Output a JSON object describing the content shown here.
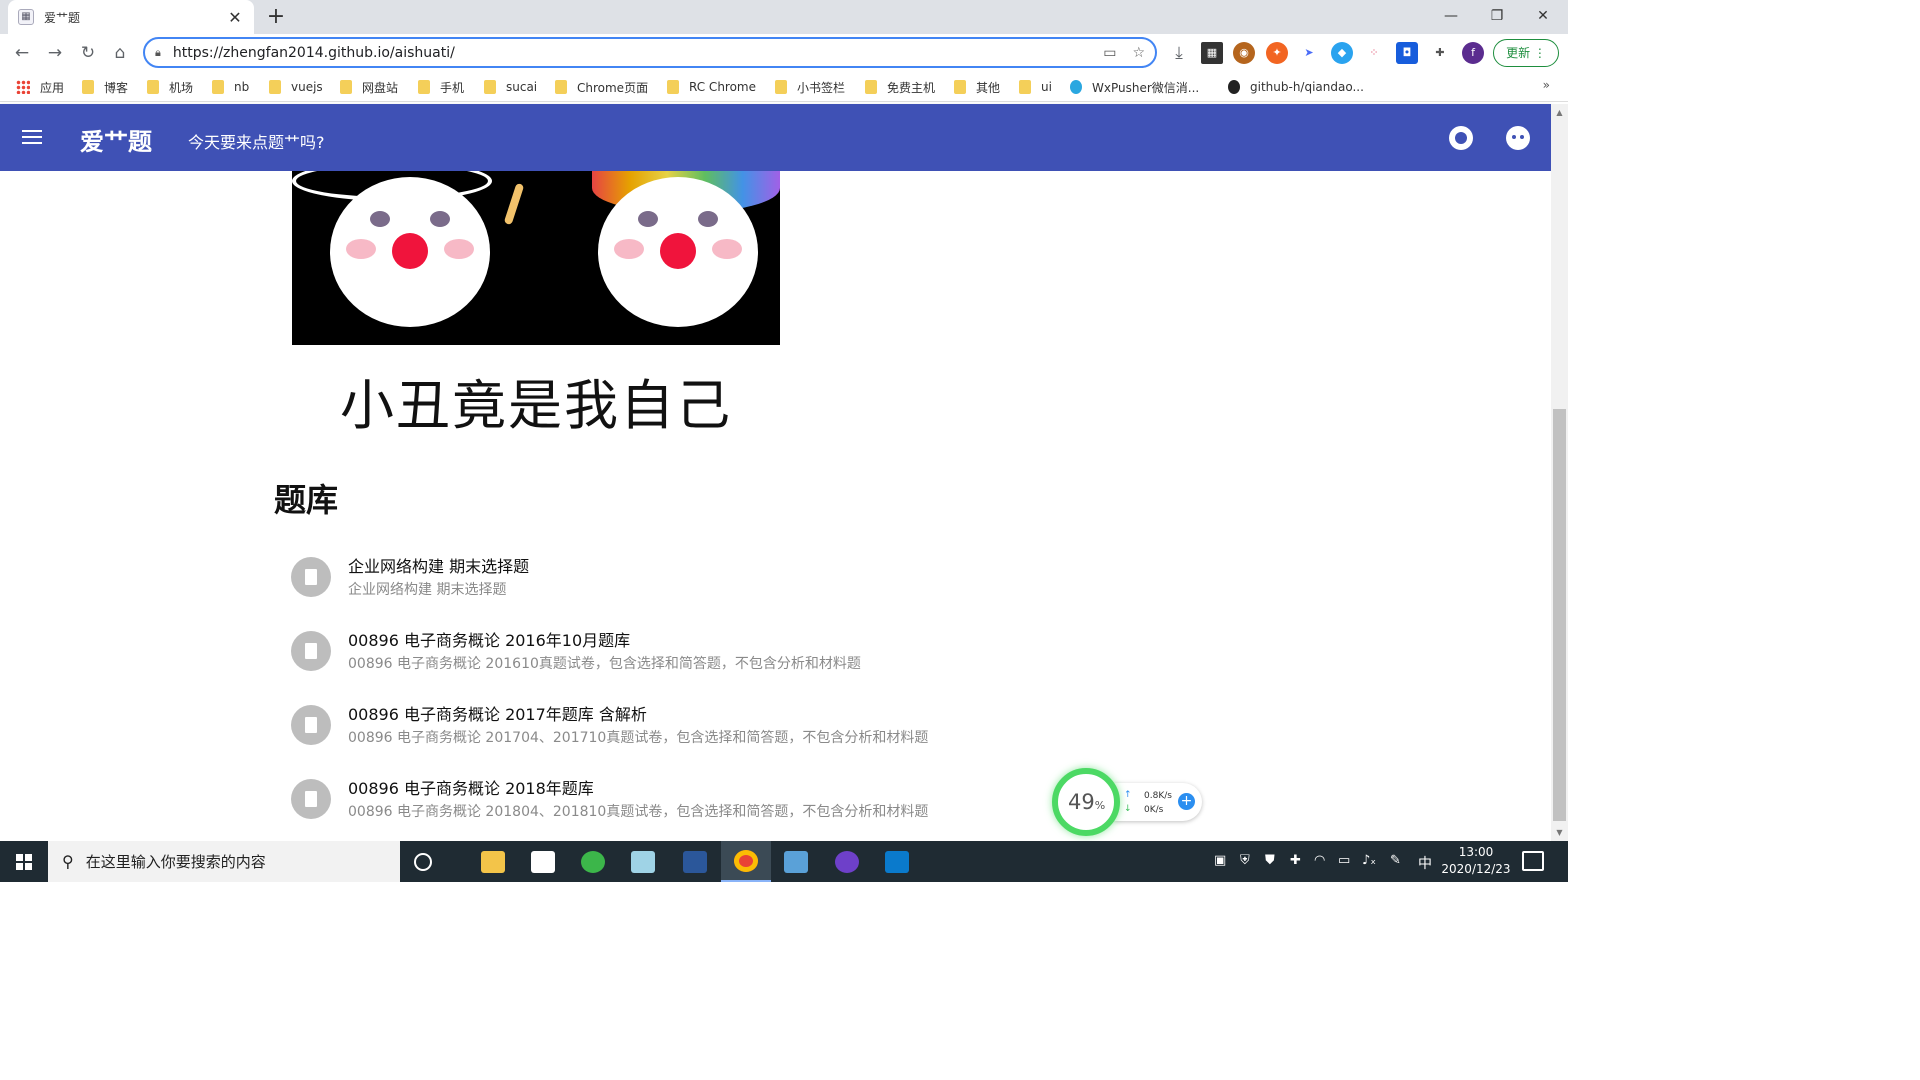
{
  "browser": {
    "tab_title": "爱艹题",
    "tab_favicon": "page-favicon-icon",
    "url": "https://zhengfan2014.github.io/aishuati/",
    "update_label": "更新",
    "profile_initial": "f",
    "bookmarks": [
      "应用",
      "博客",
      "机场",
      "nb",
      "vuejs",
      "网盘站",
      "手机",
      "sucai",
      "Chrome页面",
      "RC Chrome",
      "小书签栏",
      "免费主机",
      "其他",
      "ui",
      "WxPusher微信消...",
      "github-h/qiandao..."
    ],
    "bookmarks_more": "»"
  },
  "appbar": {
    "brand": "爱艹题",
    "slogan": "今天要来点题艹吗?",
    "color": "#3f51b5"
  },
  "content": {
    "meme_caption": "小丑竟是我自己",
    "section_title": "题库",
    "banks": [
      {
        "title": "企业网络构建 期末选择题",
        "desc": "企业网络构建 期末选择题"
      },
      {
        "title": "00896 电子商务概论 2016年10月题库",
        "desc": "00896 电子商务概论 201610真题试卷，包含选择和简答题，不包含分析和材料题"
      },
      {
        "title": "00896 电子商务概论 2017年题库 含解析",
        "desc": "00896 电子商务概论 201704、201710真题试卷，包含选择和简答题，不包含分析和材料题"
      },
      {
        "title": "00896 电子商务概论 2018年题库",
        "desc": "00896 电子商务概论 201804、201810真题试卷，包含选择和简答题，不包含分析和材料题"
      }
    ]
  },
  "net_widget": {
    "percent": "49",
    "percent_unit": "%",
    "up_speed": "0.8K/s",
    "down_speed": "0K/s",
    "up_arrow": "↑",
    "down_arrow": "↓",
    "plus": "+"
  },
  "taskbar": {
    "search_placeholder": "在这里输入你要搜索的内容",
    "ime": "中",
    "time": "13:00",
    "date": "2020/12/23"
  }
}
